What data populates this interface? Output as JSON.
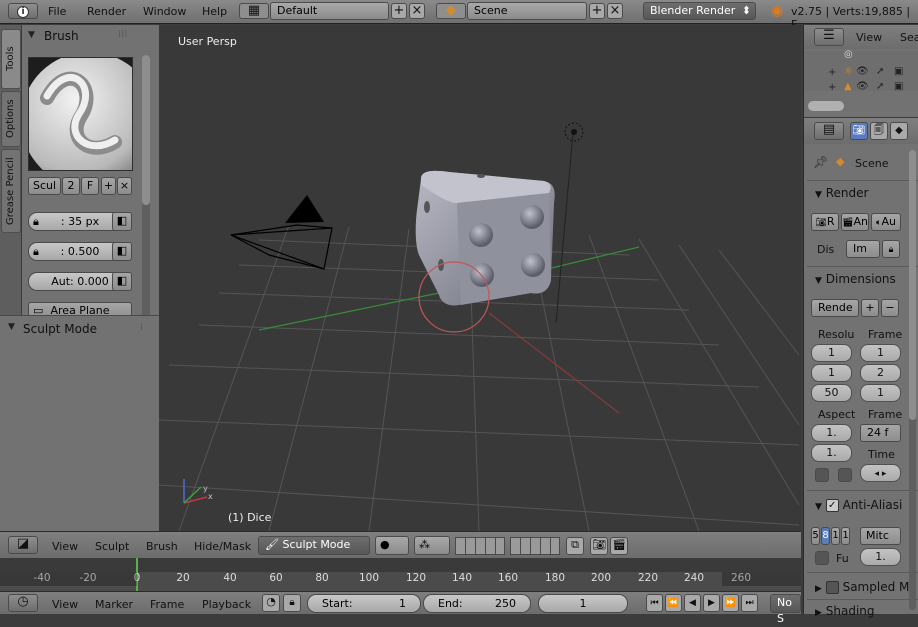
{
  "topbar": {
    "menus": [
      "File",
      "Render",
      "Window",
      "Help"
    ],
    "screen_layout": "Default",
    "scene": "Scene",
    "engine": "Blender Render",
    "version_stats": "v2.75 | Verts:19,885 | F"
  },
  "tools_panel": {
    "tabs": [
      "Tools",
      "Options",
      "Grease Pencil"
    ],
    "brush_header": "Brush",
    "brush_name": "Scul",
    "brush_users": "2",
    "brush_fake": "F",
    "radius": ": 35 px",
    "strength": ": 0.500",
    "autosmooth": "Aut: 0.000",
    "sculpt_plane": "Area Plane",
    "mode_header": "Sculpt Mode"
  },
  "viewport": {
    "view_label": "User Persp",
    "object_label": "(1) Dice"
  },
  "viewport_header": {
    "menus": [
      "View",
      "Sculpt",
      "Brush",
      "Hide/Mask"
    ],
    "mode": "Sculpt Mode"
  },
  "timeline": {
    "ticks": [
      "-40",
      "-20",
      "0",
      "20",
      "40",
      "60",
      "80",
      "100",
      "120",
      "140",
      "160",
      "180",
      "200",
      "220",
      "240",
      "260"
    ],
    "menus": [
      "View",
      "Marker",
      "Frame",
      "Playback"
    ],
    "start_label": "Start:",
    "start_value": "1",
    "end_label": "End:",
    "end_value": "250",
    "current_frame": "1",
    "sync": "No S"
  },
  "outliner": {
    "view_menu": "View",
    "search_menu": "Sea"
  },
  "properties": {
    "context_scene": "Scene",
    "render_header": "Render",
    "render_buttons": [
      "R",
      "An",
      "Au"
    ],
    "display_label": "Dis",
    "display_value": "Im",
    "dimensions_header": "Dimensions",
    "preset": "Rende",
    "resolution_label": "Resolu",
    "frame_range_label": "Frame",
    "res_x": "1",
    "res_y": "1",
    "res_pct": "50",
    "frame_start": "1",
    "frame_end": "2",
    "frame_step": "1",
    "aspect_label": "Aspect",
    "frame_rate_label": "Frame",
    "aspect_x": "1.",
    "aspect_y": "1.",
    "fps": "24 f",
    "time_label": "Time",
    "aa_header": "Anti-Aliasi",
    "aa_samples": [
      "5",
      "8",
      "1",
      "1"
    ],
    "aa_filter": "Mitc",
    "full_sample": "Fu",
    "filter_size": "1.",
    "sampled_motion": "Sampled M",
    "shading_header": "Shading"
  }
}
